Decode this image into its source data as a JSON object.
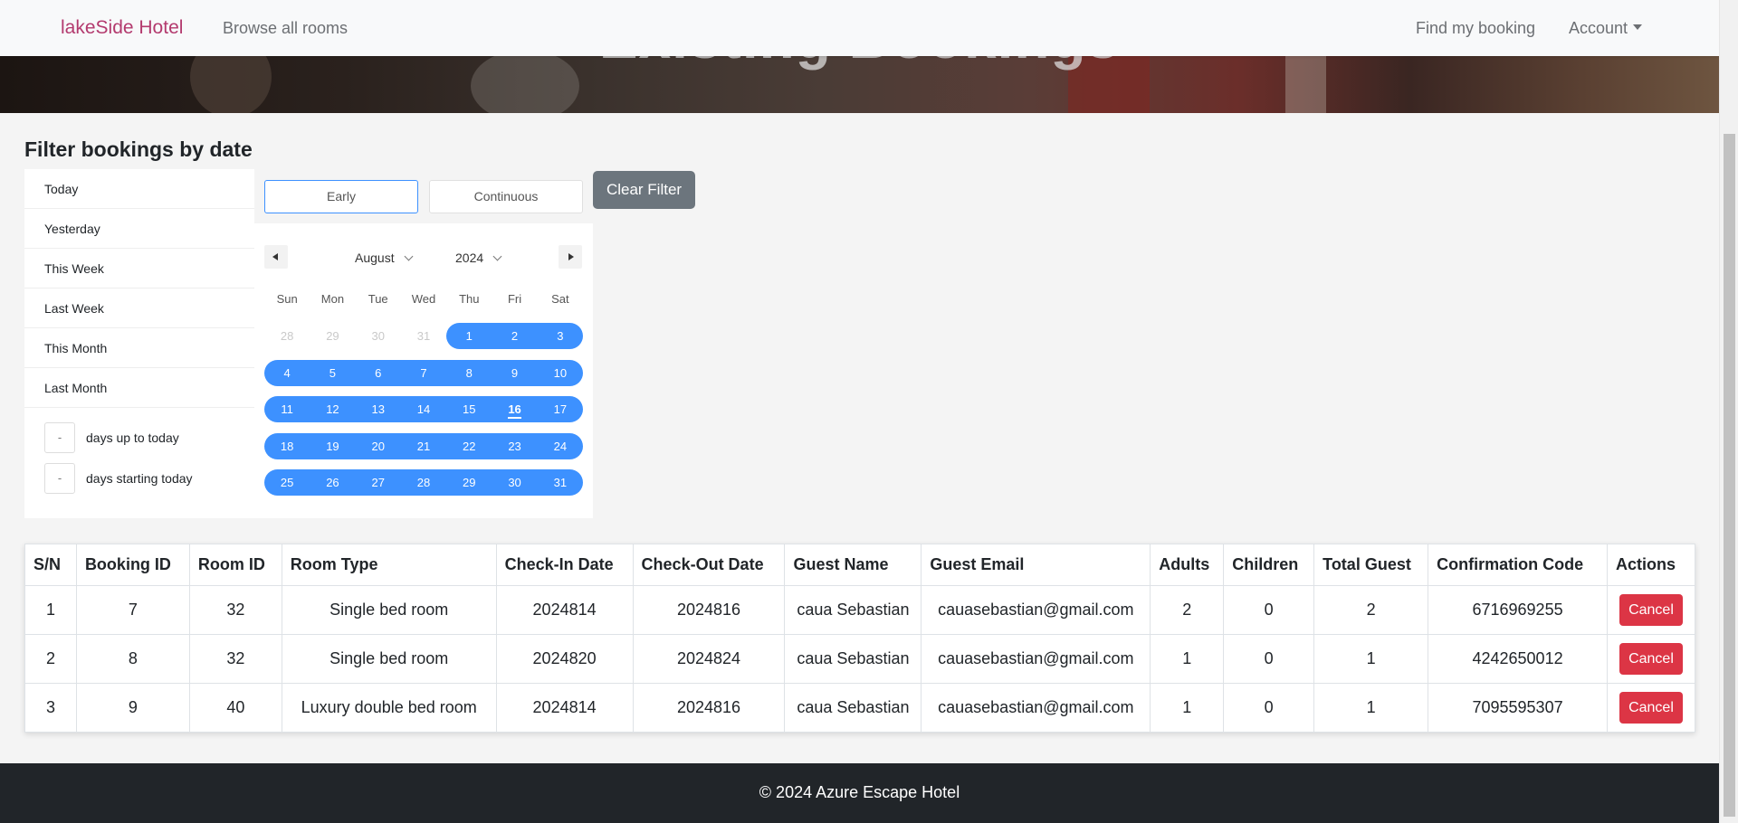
{
  "navbar": {
    "brand": "lakeSide Hotel",
    "browse_all_rooms": "Browse all rooms",
    "find_my_booking": "Find my booking",
    "account": "Account"
  },
  "hero": {
    "title": "Existing Bookings"
  },
  "filter": {
    "title": "Filter bookings by date",
    "presets": [
      "Today",
      "Yesterday",
      "This Week",
      "Last Week",
      "This Month",
      "Last Month"
    ],
    "range_up_value": "-",
    "range_up_label": "days up to today",
    "range_start_value": "-",
    "range_start_label": "days starting today",
    "tab_early": "Early",
    "tab_continuous": "Continuous",
    "clear_button": "Clear Filter"
  },
  "calendar": {
    "month": "August",
    "year": "2024",
    "weekdays": [
      "Sun",
      "Mon",
      "Tue",
      "Wed",
      "Thu",
      "Fri",
      "Sat"
    ],
    "weeks": [
      [
        "28",
        "29",
        "30",
        "31",
        "1",
        "2",
        "3"
      ],
      [
        "4",
        "5",
        "6",
        "7",
        "8",
        "9",
        "10"
      ],
      [
        "11",
        "12",
        "13",
        "14",
        "15",
        "16",
        "17"
      ],
      [
        "18",
        "19",
        "20",
        "21",
        "22",
        "23",
        "24"
      ],
      [
        "25",
        "26",
        "27",
        "28",
        "29",
        "30",
        "31"
      ]
    ],
    "today": "16",
    "selection_color": "#3d91ff"
  },
  "table": {
    "headers": [
      "S/N",
      "Booking ID",
      "Room ID",
      "Room Type",
      "Check-In Date",
      "Check-Out Date",
      "Guest Name",
      "Guest Email",
      "Adults",
      "Children",
      "Total Guest",
      "Confirmation Code",
      "Actions"
    ],
    "rows": [
      [
        "1",
        "7",
        "32",
        "Single bed room",
        "2024814",
        "2024816",
        "caua Sebastian",
        "cauasebastian@gmail.com",
        "2",
        "0",
        "2",
        "6716969255"
      ],
      [
        "2",
        "8",
        "32",
        "Single bed room",
        "2024820",
        "2024824",
        "caua Sebastian",
        "cauasebastian@gmail.com",
        "1",
        "0",
        "1",
        "4242650012"
      ],
      [
        "3",
        "9",
        "40",
        "Luxury double bed room",
        "2024814",
        "2024816",
        "caua Sebastian",
        "cauasebastian@gmail.com",
        "1",
        "0",
        "1",
        "7095595307"
      ]
    ],
    "cancel_label": "Cancel",
    "cancel_color": "#dc3545"
  },
  "footer": {
    "text": "© 2024 Azure Escape Hotel"
  }
}
